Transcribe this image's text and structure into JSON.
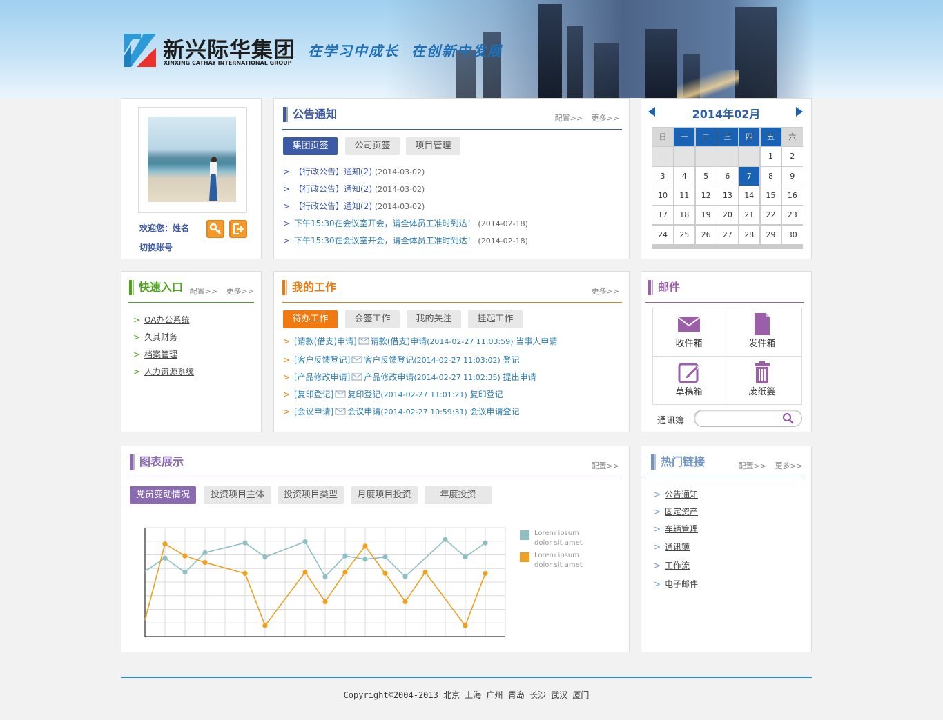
{
  "brand": {
    "name_cn": "新兴际华集团",
    "name_en": "XINXING CATHAY INTERNATIONAL GROUP",
    "slogan": "在学习中成长  在创新中发展"
  },
  "colors": {
    "primary_blue": "#3b56a8",
    "announcement": "#3d5aa6",
    "quick_green": "#4ea31a",
    "work_orange": "#f07a10",
    "mail_purple": "#9a5fa8",
    "chart_purple": "#8a6bb0",
    "links_blue": "#6f95c9",
    "calendar_today": "#1a62b3",
    "footer_line": "#2a8dd4"
  },
  "user": {
    "welcome": "欢迎您：姓名",
    "switch_account": "切换账号",
    "key_icon": "key-icon",
    "logout_icon": "logout-icon"
  },
  "announcement": {
    "title": "公告通知",
    "config": "配置>>",
    "more": "更多>>",
    "tabs": [
      "集团页签",
      "公司页签",
      "项目管理"
    ],
    "items": [
      {
        "text": "【行政公告】通知(2)",
        "date": "(2014-03-02)"
      },
      {
        "text": "【行政公告】通知(2)",
        "date": "(2014-03-02)"
      },
      {
        "text": "【行政公告】通知(2)",
        "date": "(2014-03-02)"
      },
      {
        "text": "下午15:30在会议室开会，请全体员工准时到达！",
        "date": "(2014-02-18)"
      },
      {
        "text": "下午15:30在会议室开会，请全体员工准时到达！",
        "date": "(2014-02-18)"
      }
    ]
  },
  "calendar": {
    "title": "2014年02月",
    "prev_icon": "triangle-left-icon",
    "next_icon": "triangle-right-icon",
    "weekdays": [
      "日",
      "一",
      "二",
      "三",
      "四",
      "五",
      "六"
    ],
    "days": [
      "",
      "",
      "",
      "",
      "",
      "1",
      "2",
      "3",
      "4",
      "5",
      "6",
      "7",
      "8",
      "9",
      "10",
      "11",
      "12",
      "13",
      "14",
      "15",
      "16",
      "17",
      "18",
      "19",
      "20",
      "21",
      "22",
      "23",
      "24",
      "25",
      "26",
      "27",
      "28",
      "29",
      "30"
    ],
    "today": "7"
  },
  "quick_entry": {
    "title": "快速入口",
    "config": "配置>>",
    "more": "更多>>",
    "items": [
      "OA办公系统",
      "久其财务",
      "档案管理",
      "人力资源系统"
    ]
  },
  "my_work": {
    "title": "我的工作",
    "more": "更多>>",
    "tabs": [
      "待办工作",
      "会签工作",
      "我的关注",
      "挂起工作"
    ],
    "items": [
      {
        "type": "[请款(借支)申请]",
        "text": "请款(借支)申请",
        "time": "(2014-02-27 11:03:59)",
        "suffix": "当事人申请"
      },
      {
        "type": "[客户反馈登记]",
        "text": "客户反馈登记",
        "time": "(2014-02-27 11:03:02)",
        "suffix": "登记"
      },
      {
        "type": "[产品修改申请]",
        "text": "产品修改申请",
        "time": "(2014-02-27 11:02:35)",
        "suffix": "提出申请"
      },
      {
        "type": "[复印登记]",
        "text": "复印登记",
        "time": "(2014-02-27 11:01:21)",
        "suffix": "复印登记"
      },
      {
        "type": "[会议申请]",
        "text": "会议申请",
        "time": "(2014-02-27 10:59:31)",
        "suffix": "会议申请登记"
      }
    ]
  },
  "mail": {
    "title": "邮件",
    "inbox": "收件箱",
    "outbox": "发件箱",
    "drafts": "草稿箱",
    "trash": "废纸篓",
    "contacts": "通讯簿",
    "search_placeholder": ""
  },
  "chart_panel": {
    "title": "图表展示",
    "config": "配置>>",
    "tabs": [
      "党员变动情况",
      "投资项目主体",
      "投资项目类型",
      "月度项目投资",
      "年度投资"
    ]
  },
  "chart_data": {
    "type": "line",
    "title": "",
    "xlabel": "",
    "ylabel": "",
    "ylim": [
      0,
      10
    ],
    "x": [
      0,
      1,
      2,
      3,
      4,
      5,
      6,
      7,
      8,
      9,
      10,
      11,
      12,
      13,
      14,
      15,
      16,
      17,
      18
    ],
    "grid": true,
    "legend_position": "right",
    "series": [
      {
        "name": "Lorem ipsum dolor sit amet",
        "color": "#8fbfc3",
        "points": [
          [
            0,
            6
          ],
          [
            1,
            7.2
          ],
          [
            2,
            5.9
          ],
          [
            3,
            7.7
          ],
          [
            5,
            8.6
          ],
          [
            6,
            7.3
          ],
          [
            8,
            8.7
          ],
          [
            9,
            5.5
          ],
          [
            10,
            7.4
          ],
          [
            11,
            7.1
          ],
          [
            12,
            7.3
          ],
          [
            13,
            5.5
          ],
          [
            15,
            8.9
          ],
          [
            16,
            7.3
          ],
          [
            17,
            8.6
          ]
        ]
      },
      {
        "name": "Lorem ipsum dolor sit amet",
        "color": "#f0a020",
        "points": [
          [
            0,
            1.5
          ],
          [
            1,
            8.5
          ],
          [
            2,
            7.4
          ],
          [
            3,
            6.8
          ],
          [
            5,
            5.8
          ],
          [
            6,
            1
          ],
          [
            8,
            5.9
          ],
          [
            9,
            3.2
          ],
          [
            10,
            5.9
          ],
          [
            11,
            8.3
          ],
          [
            12,
            5.8
          ],
          [
            13,
            3.2
          ],
          [
            14,
            5.9
          ],
          [
            16,
            1
          ],
          [
            17,
            5.8
          ]
        ]
      }
    ]
  },
  "hot_links": {
    "title": "热门链接",
    "config": "配置>>",
    "more": "更多>>",
    "items": [
      "公告通知",
      "固定资产",
      "车辆管理",
      "通讯簿",
      "工作流",
      "电子邮件"
    ]
  },
  "footer": {
    "text": "Copyright©2004-2013 北京 上海 广州 青岛 长沙 武汉 厦门"
  }
}
